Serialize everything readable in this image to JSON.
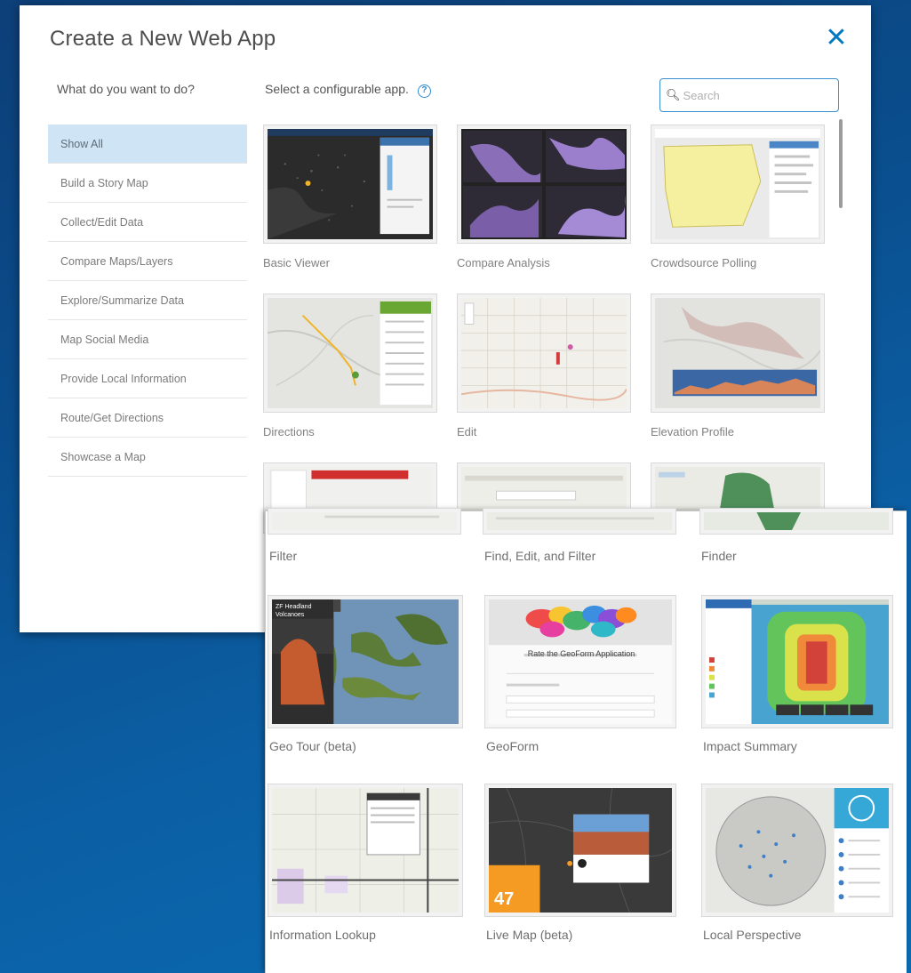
{
  "dialog": {
    "title": "Create a New Web App",
    "question": "What do you want to do?",
    "select_label": "Select a configurable app.",
    "search_placeholder": "Search"
  },
  "sidebar": {
    "items": [
      {
        "label": "Show All",
        "active": true
      },
      {
        "label": "Build a Story Map"
      },
      {
        "label": "Collect/Edit Data"
      },
      {
        "label": "Compare Maps/Layers"
      },
      {
        "label": "Explore/Summarize Data"
      },
      {
        "label": "Map Social Media"
      },
      {
        "label": "Provide Local Information"
      },
      {
        "label": "Route/Get Directions"
      },
      {
        "label": "Showcase a Map"
      }
    ]
  },
  "apps": [
    {
      "label": "Basic Viewer",
      "icon": "basic-viewer-thumbnail"
    },
    {
      "label": "Compare Analysis",
      "icon": "compare-analysis-thumbnail"
    },
    {
      "label": "Crowdsource Polling",
      "icon": "crowdsource-polling-thumbnail"
    },
    {
      "label": "Directions",
      "icon": "directions-thumbnail"
    },
    {
      "label": "Edit",
      "icon": "edit-thumbnail"
    },
    {
      "label": "Elevation Profile",
      "icon": "elevation-profile-thumbnail"
    }
  ],
  "zoom_apps": [
    {
      "label": "Filter"
    },
    {
      "label": "Find, Edit, and Filter"
    },
    {
      "label": "Finder"
    },
    {
      "label": "Geo Tour (beta)",
      "icon": "geo-tour-thumbnail",
      "overlay_text": "ZF Headland Volcanoes"
    },
    {
      "label": "GeoForm",
      "icon": "geoform-thumbnail",
      "overlay_text": "Rate the GeoForm Application"
    },
    {
      "label": "Impact Summary",
      "icon": "impact-summary-thumbnail"
    },
    {
      "label": "Information Lookup",
      "icon": "information-lookup-thumbnail"
    },
    {
      "label": "Live Map (beta)",
      "icon": "live-map-thumbnail",
      "overlay_text": "47"
    },
    {
      "label": "Local Perspective",
      "icon": "local-perspective-thumbnail"
    }
  ],
  "colors": {
    "accent": "#0079c1",
    "active_bg": "#cfe4f4",
    "background": "#0a4d8c",
    "live_map_orange": "#f59a23"
  }
}
